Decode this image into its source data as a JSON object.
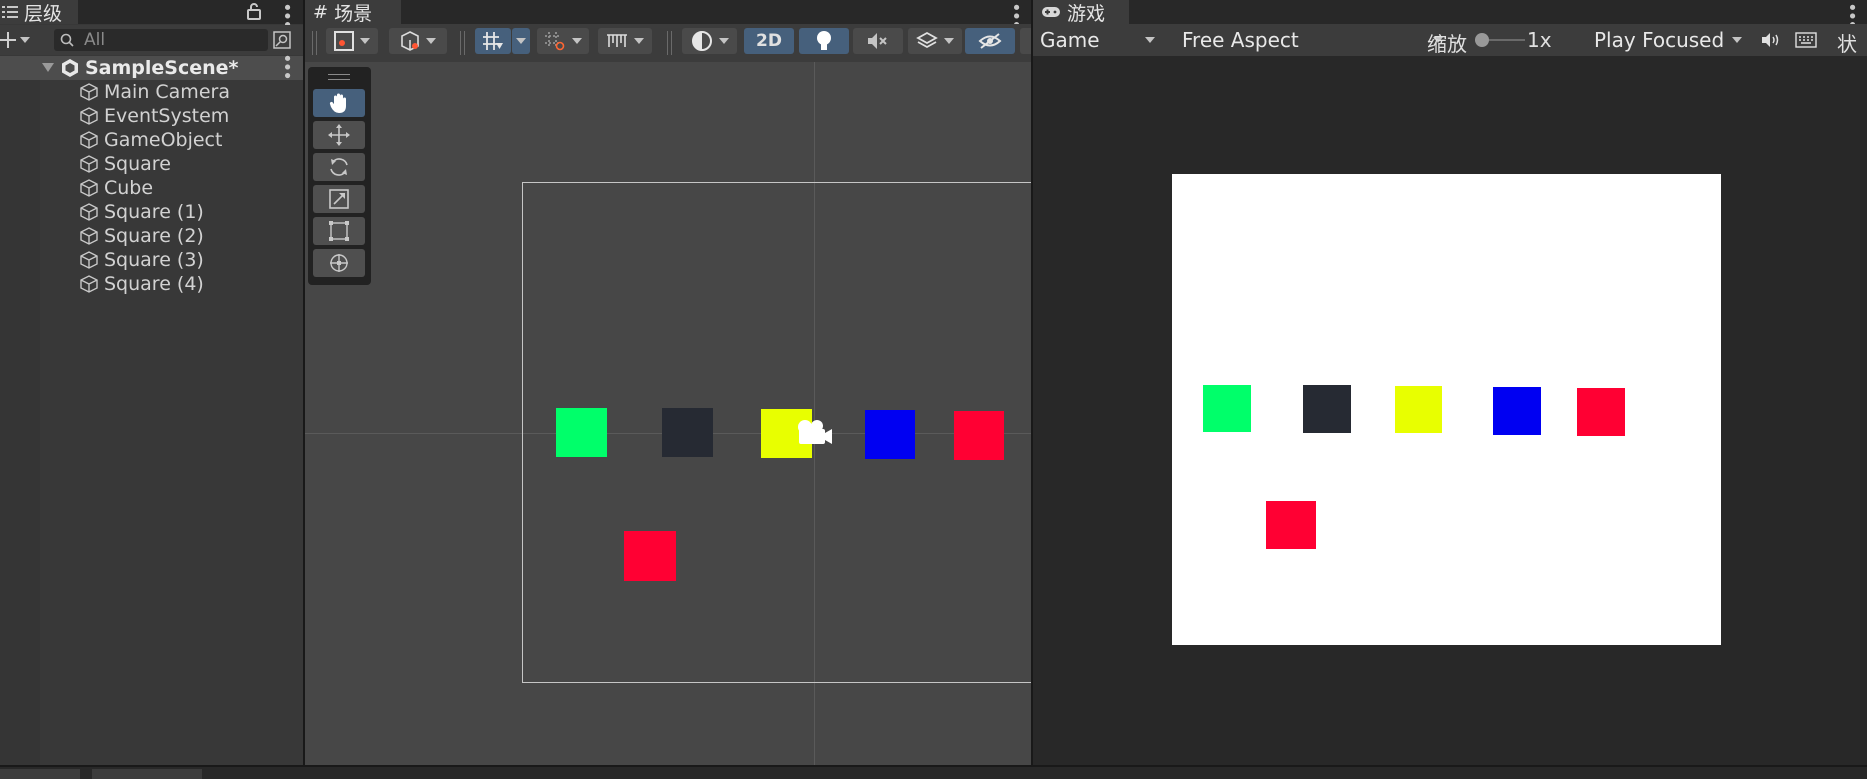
{
  "hierarchy": {
    "tab_label": "层级",
    "search_placeholder": "All",
    "scene_name": "SampleScene*",
    "items": [
      "Main Camera",
      "EventSystem",
      "GameObject",
      "Square",
      "Cube",
      "Square (1)",
      "Square (2)",
      "Square (3)",
      "Square (4)"
    ]
  },
  "scene": {
    "tab_label": "场景",
    "mode_2d_label": "2D"
  },
  "game": {
    "tab_label": "游戏",
    "display_select": "Game",
    "aspect_select": "Free Aspect",
    "scale_label": "缩放",
    "scale_value": "1x",
    "play_mode_select": "Play Focused",
    "stats_label": "状"
  },
  "colors": {
    "green": "#00ff6a",
    "dark": "#262a33",
    "yellow": "#e8ff00",
    "blue": "#0000f2",
    "red": "#ff0033",
    "accent": "#46607c"
  },
  "icons": [
    "hierarchy-list-icon",
    "lock-icon",
    "search-icon",
    "unity-scene-icon",
    "cube-icon",
    "hand-tool-icon",
    "move-tool-icon",
    "rotate-tool-icon",
    "scale-tool-icon",
    "rect-tool-icon",
    "transform-tool-icon",
    "camera-gizmo-icon",
    "gamepad-icon",
    "audio-icon",
    "keyboard-icon"
  ]
}
